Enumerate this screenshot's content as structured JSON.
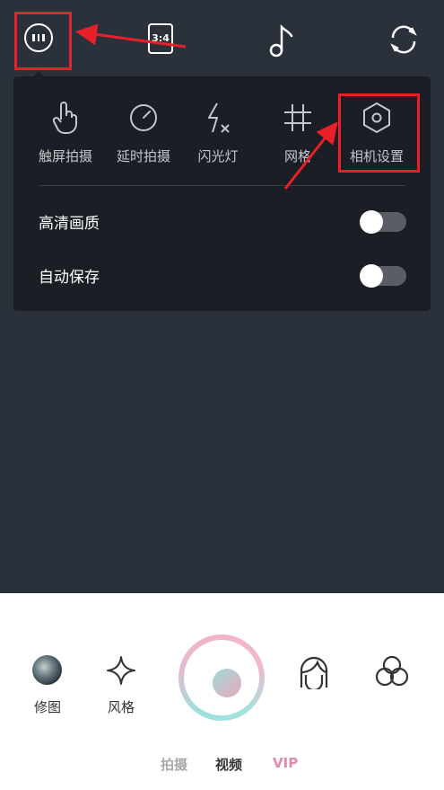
{
  "topbar": {
    "ratio_label": "3:4",
    "icons": [
      "more-icon",
      "aspect-ratio-icon",
      "music-note-icon",
      "flip-camera-icon"
    ]
  },
  "panel": {
    "tools": [
      {
        "label": "触屏拍摄",
        "icon": "touch-hand-icon"
      },
      {
        "label": "延时拍摄",
        "icon": "timer-icon"
      },
      {
        "label": "闪光灯",
        "icon": "flash-off-icon"
      },
      {
        "label": "网格",
        "icon": "grid-icon"
      },
      {
        "label": "相机设置",
        "icon": "hexagon-settings-icon"
      }
    ],
    "settings": [
      {
        "label": "高清画质",
        "enabled": false
      },
      {
        "label": "自动保存",
        "enabled": false
      }
    ]
  },
  "bottom": {
    "edit_label": "修图",
    "style_label": "风格",
    "modes": [
      "拍摄",
      "视频",
      "VIP"
    ],
    "active_mode": "视频"
  },
  "colors": {
    "background": "#2b313a",
    "panel": "#1b1f25",
    "annotation_red": "#e8202a",
    "vip_pink": "#e38aa9",
    "shutter_teal": "#9fe0dc",
    "shutter_pink": "#f3b3c7"
  }
}
